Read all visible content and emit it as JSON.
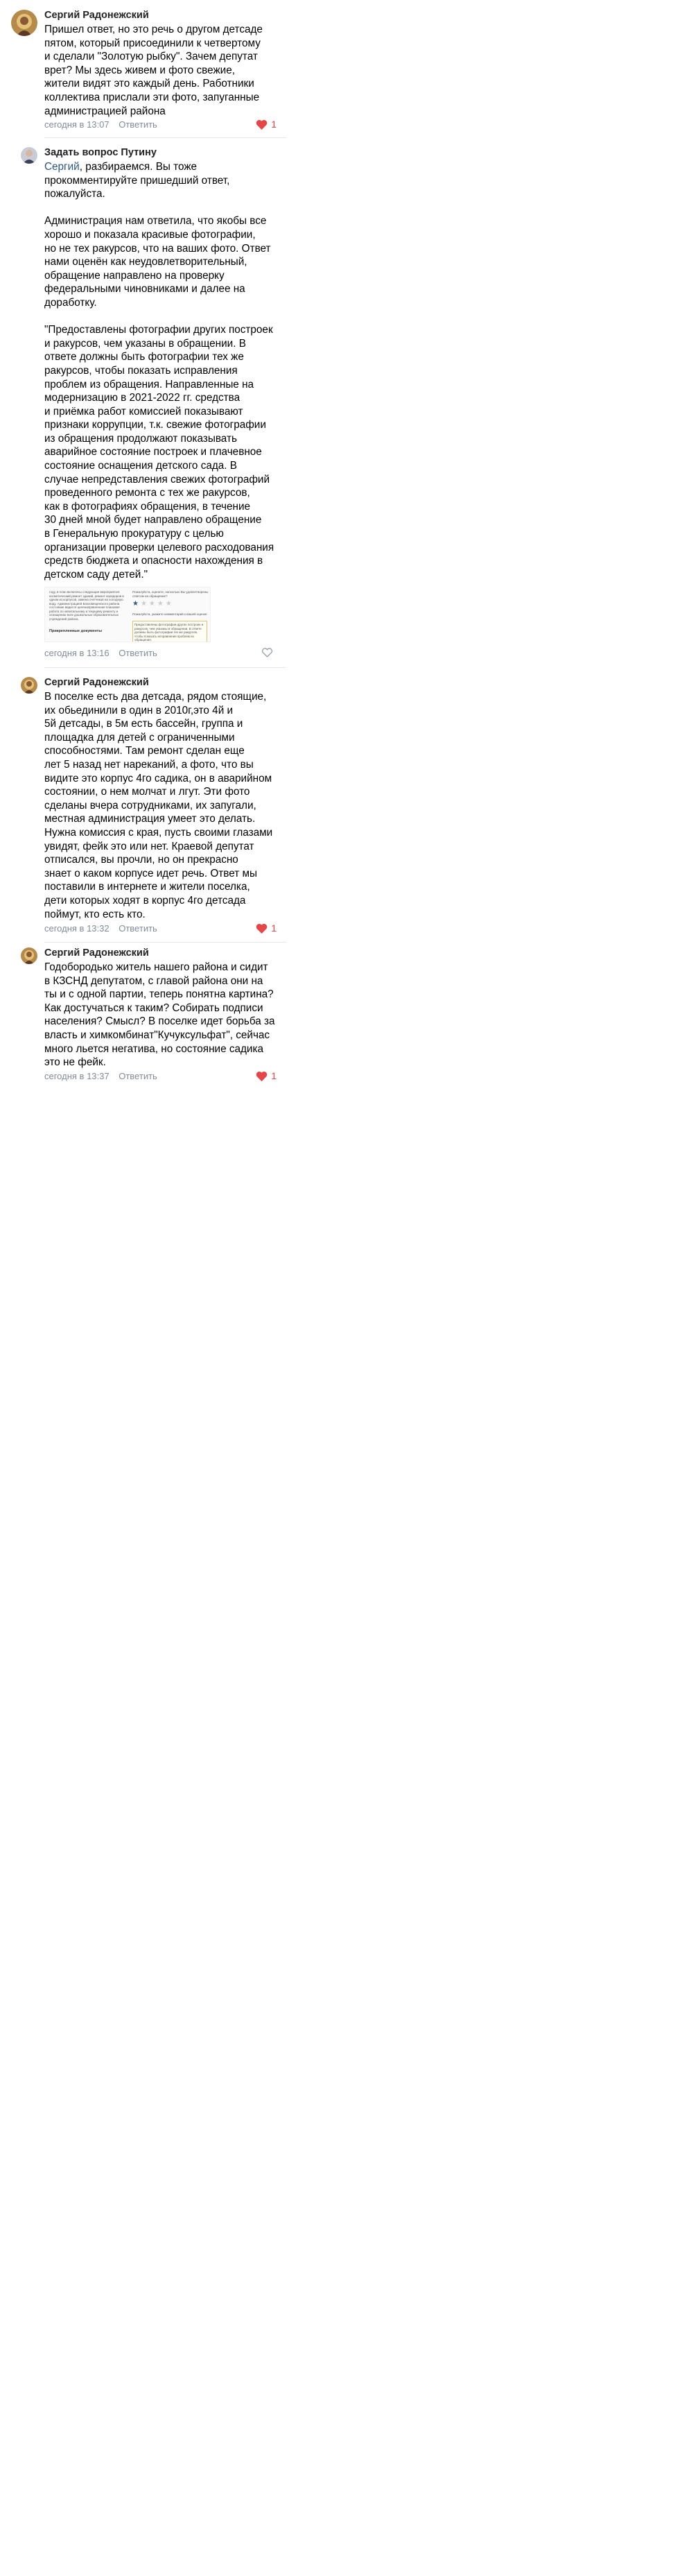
{
  "comments": [
    {
      "author": "Сергий Радонежский",
      "lines": [
        "Пришел ответ, но это речь о другом детсаде",
        "пятом, который присоединили к четвертому",
        "и сделали \"Золотую рыбку\". Зачем депутат",
        "врет? Мы здесь живем и фото свежие,",
        "жители видят это каждый день. Работники",
        "коллектива прислали эти фото, запуганные",
        "администрацией района"
      ],
      "time": "сегодня в 13:07",
      "reply_label": "Ответить",
      "likes": "1",
      "liked": true
    },
    {
      "author": "Задать вопрос Путину",
      "mention": "Сергий",
      "first_line_rest": ", разбираемся. Вы тоже",
      "lines": [
        "прокомментируйте пришедший ответ,",
        "пожалуйста.",
        "",
        "Администрация нам ответила, что якобы все",
        "хорошо и показала красивые фотографии,",
        "но не тех ракурсов, что на ваших фото. Ответ",
        "нами оценён как неудовлетворительный,",
        "обращение направлено на проверку",
        "федеральными чиновниками и далее на",
        "доработку.",
        "",
        "\"Предоставлены фотографии других построек",
        "и ракурсов, чем указаны в обращении. В",
        "ответе должны быть фотографии тех же",
        "ракурсов, чтобы показать исправления",
        "проблем из обращения. Направленные на",
        "модернизацию в 2021-2022 гг. средства",
        "и приёмка работ комиссией показывают",
        "признаки коррупции, т.к. свежие фотографии",
        "из обращения продолжают показывать",
        "аварийное состояние построек и плачевное",
        "состояние оснащения детского сада. В",
        "случае непредставления свежих фотографий",
        "проведенного ремонта с тех же ракурсов,",
        "как в фотографиях обращения, в течение",
        "30 дней мной будет направлено обращение",
        "в Генеральную прокуратуру с целью",
        "организации проверки целевого расходования",
        "средств бюджета и опасности нахождения в",
        "детском саду детей.\""
      ],
      "attachment": {
        "left_text": "году, в план включены следующие мероприятия: косметический ремонт зданий, ремонт коридоров в одном из корпусов, замена счетчиков на холодную воду. Администрацией Благовещенского района состояние видится целенаправленная плановая работа по капитальному и текущему ремонту и оснащению всех дошкольных образовательных учреждений района.",
        "docs_label": "Прикрепленные документы",
        "right_question": "Пожалуйста, оцените, насколько Вы удовлетворены ответом на обращение?",
        "right_note": "Пожалуйста, укажите комментарий к вашей оценке:",
        "quote": "Предоставлены фотографии других построек и ракурсов, чем указаны в обращении. В ответе должны быть фотографии тех же ракурсов, чтобы показать исправления проблем из обращения."
      },
      "time": "сегодня в 13:16",
      "reply_label": "Ответить",
      "likes": "",
      "liked": false
    },
    {
      "author": "Сергий Радонежский",
      "lines": [
        "В поселке есть два детсада, рядом стоящие,",
        "их обьединили в один в 2010г,это 4й и",
        "5й детсады, в 5м есть бассейн, группа и",
        "площадка для детей с ограниченными",
        "способностями. Там ремонт сделан еще",
        "лет 5 назад нет нареканий, а фото, что вы",
        "видите это корпус 4го садика, он в аварийном",
        "состоянии, о нем молчат и лгут. Эти фото",
        "сделаны вчера сотрудниками, их запугали,",
        "местная администрация умеет это делать.",
        "Нужна комиссия с края, пусть своими глазами",
        "увидят, фейк это или нет. Краевой депутат",
        "отписался, вы прочли, но он прекрасно",
        "знает о каком корпусе идет речь. Ответ мы",
        "поставили в интернете и жители поселка,",
        "дети которых ходят в корпус 4го детсада",
        "поймут, кто есть кто."
      ],
      "time": "сегодня в 13:32",
      "reply_label": "Ответить",
      "likes": "1",
      "liked": true
    },
    {
      "author": "Сергий Радонежский",
      "lines": [
        "Годобородько житель нашего района и сидит",
        "в КЗСНД депутатом, с главой района они на",
        "ты и с одной партии, теперь понятна картина?",
        "Как достучаться к таким? Собирать подписи",
        "населения? Смысл? В поселке идет борьба за",
        "власть и химкомбинат\"Кучуксульфат\", сейчас",
        "много льется негатива, но состояние садика",
        "это не фейк."
      ],
      "time": "сегодня в 13:37",
      "reply_label": "Ответить",
      "likes": "1",
      "liked": true
    }
  ],
  "icons": {
    "heart_filled": "heart-filled-icon",
    "heart_outline": "heart-outline-icon"
  },
  "colors": {
    "like_red": "#e64646",
    "link_blue": "#2a5885",
    "meta_gray": "#818c99"
  }
}
